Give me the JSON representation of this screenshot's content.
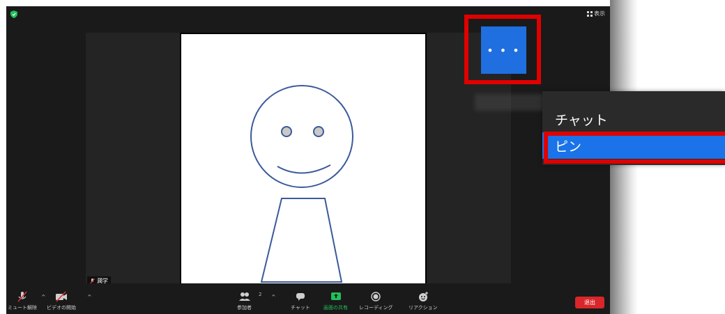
{
  "header": {
    "view_label": "表示"
  },
  "participant": {
    "name": "潤学"
  },
  "more_button": {
    "label": "• • •"
  },
  "context_menu": {
    "items": [
      {
        "label": "チャット"
      },
      {
        "label": "ピン",
        "selected": true
      }
    ]
  },
  "toolbar": {
    "unmute_label": "ミュート解除",
    "start_video_label": "ビデオの開始",
    "participants_label": "参加者",
    "participants_count": "2",
    "chat_label": "チャット",
    "share_label": "画面の共有",
    "record_label": "レコーディング",
    "reactions_label": "リアクション",
    "leave_label": "退出"
  },
  "colors": {
    "accent_blue": "#1f6fe0",
    "menu_selected": "#1a73e8",
    "highlight_red": "#e00000",
    "leave_red": "#d9262a",
    "share_green": "#21c05a",
    "shield_green": "#21c05a"
  },
  "icons": [
    "shield-icon",
    "grid-icon",
    "mic-muted-icon",
    "video-off-icon",
    "participants-icon",
    "chat-icon",
    "share-screen-icon",
    "record-icon",
    "reactions-icon"
  ]
}
